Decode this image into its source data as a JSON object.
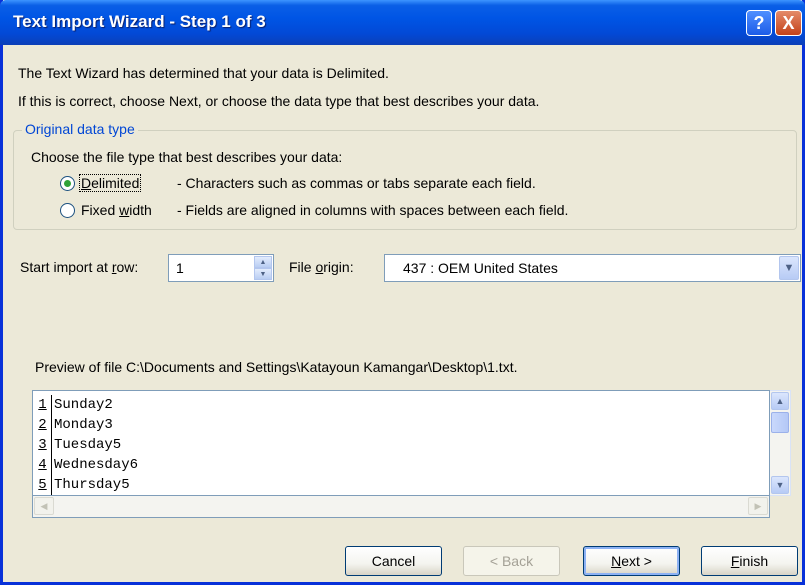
{
  "window": {
    "title": "Text Import Wizard - Step 1 of 3",
    "help_glyph": "?",
    "close_glyph": "X"
  },
  "intro": {
    "line1": "The Text Wizard has determined that your data is Delimited.",
    "line2": "If this is correct, choose Next, or choose the data type that best describes your data."
  },
  "original_data_type": {
    "legend": "Original data type",
    "prompt": "Choose the file type that best describes your data:",
    "options": [
      {
        "label_pre": "",
        "label_u": "D",
        "label_post": "elimited",
        "description": "- Characters such as commas or tabs separate each field.",
        "selected": true
      },
      {
        "label_pre": "Fixed ",
        "label_u": "w",
        "label_post": "idth",
        "description": "- Fields are aligned in columns with spaces between each field.",
        "selected": false
      }
    ]
  },
  "start_import": {
    "label_pre": "Start import at ",
    "label_u": "r",
    "label_post": "ow:",
    "value": "1"
  },
  "file_origin": {
    "label_pre": "File ",
    "label_u": "o",
    "label_post": "rigin:",
    "value": "437 : OEM United States"
  },
  "preview": {
    "label": "Preview of file C:\\Documents and Settings\\Katayoun Kamangar\\Desktop\\1.txt.",
    "rows": [
      {
        "num": "1",
        "text": "Sunday2"
      },
      {
        "num": "2",
        "text": "Monday3"
      },
      {
        "num": "3",
        "text": "Tuesday5"
      },
      {
        "num": "4",
        "text": "Wednesday6"
      },
      {
        "num": "5",
        "text": "Thursday5"
      }
    ]
  },
  "buttons": {
    "cancel": "Cancel",
    "back": "< Back",
    "next_u": "N",
    "next_post": "ext >",
    "finish_u": "F",
    "finish_post": "inish"
  },
  "colors": {
    "titlebar": "#0055e5",
    "dialog_bg": "#ece9d8",
    "legend_text": "#0046d5",
    "radio_dot": "#2fa237"
  }
}
